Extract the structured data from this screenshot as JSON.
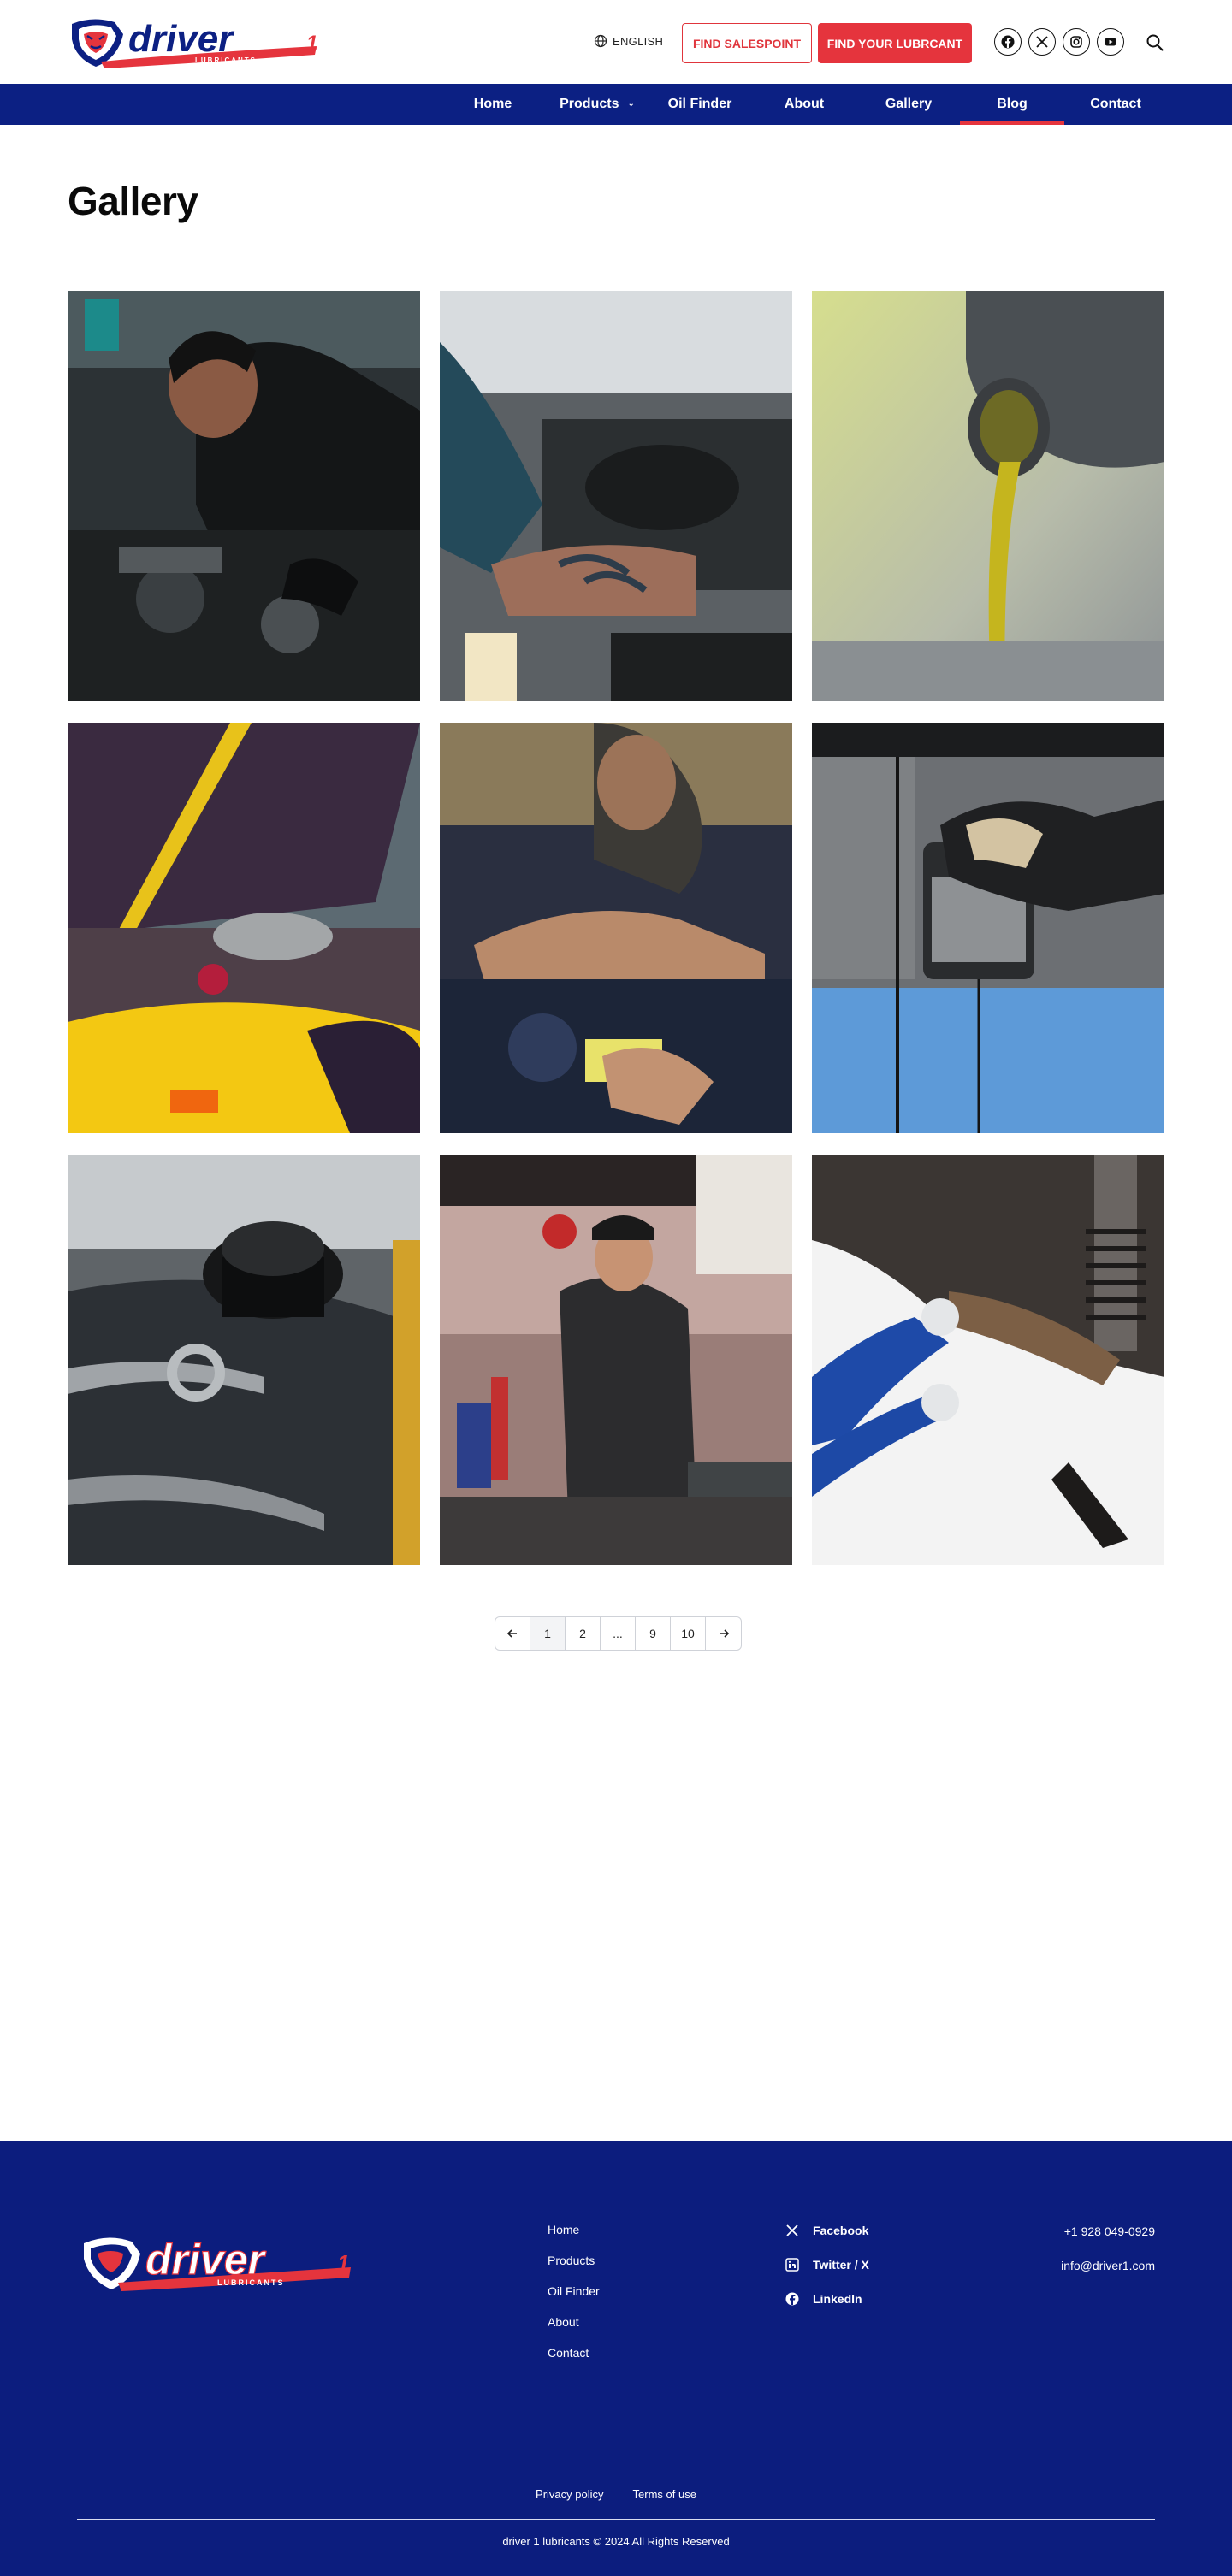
{
  "header": {
    "logo_text": "driver",
    "logo_sub": "LUBRICANTS",
    "logo_num": "1",
    "language": "ENGLISH",
    "find_salespoint": "FIND SALESPOINT",
    "find_lubricant": "FIND YOUR LUBRCANT",
    "social_icons": [
      "facebook-icon",
      "x-icon",
      "instagram-icon",
      "youtube-icon"
    ]
  },
  "nav": {
    "items": [
      {
        "label": "Home"
      },
      {
        "label": "Products",
        "has_dropdown": true
      },
      {
        "label": "Oil Finder"
      },
      {
        "label": "About"
      },
      {
        "label": "Gallery"
      },
      {
        "label": "Blog",
        "active": true
      },
      {
        "label": "Contact"
      }
    ]
  },
  "page": {
    "title": "Gallery"
  },
  "gallery": {
    "images": [
      "mechanic in black uniform working on engine",
      "tattooed arm working on engine",
      "motor oil pouring from bottle",
      "yellow car with open hood",
      "mechanic leaning over engine bay",
      "gloved hand pouring oil from filter",
      "wrenches and oil cap",
      "mechanic in cap at workshop",
      "gloved hands inspecting suspension"
    ]
  },
  "pagination": {
    "pages": [
      "1",
      "2",
      "...",
      "9",
      "10"
    ],
    "current": "1"
  },
  "footer": {
    "links": [
      "Home",
      "Products",
      "Oil Finder",
      "About",
      "Contact"
    ],
    "social": [
      {
        "label": "Facebook",
        "icon": "x-icon"
      },
      {
        "label": "Twitter / X",
        "icon": "linkedin-icon"
      },
      {
        "label": "LinkedIn",
        "icon": "facebook-icon"
      }
    ],
    "phone": "+1 928 049-0929",
    "email": "info@driver1.com",
    "privacy": "Privacy policy",
    "terms": "Terms of use",
    "copyright": "driver 1 lubricants © 2024 All Rights Reserved"
  },
  "colors": {
    "brand_blue": "#0c2083",
    "brand_red": "#e5343d",
    "footer_blue": "#0c1d7e"
  }
}
